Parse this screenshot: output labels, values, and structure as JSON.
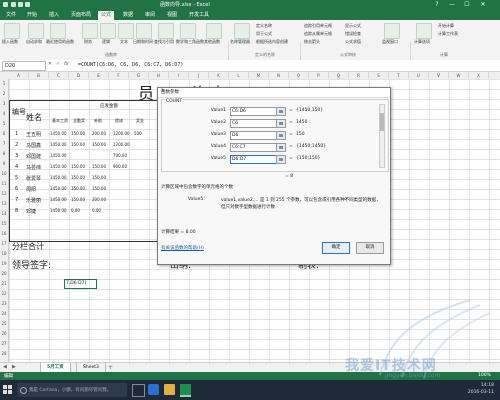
{
  "window": {
    "title": "函数向导.xlsx - Excel",
    "controls": [
      "?",
      "—",
      "☐",
      "✕"
    ]
  },
  "ribbon_tabs": [
    "文件",
    "开始",
    "插入",
    "页面布局",
    "公式",
    "数据",
    "审阅",
    "视图",
    "开发工具"
  ],
  "active_tab_index": 4,
  "ribbon": {
    "buttons": [
      {
        "label": "插入函数"
      },
      {
        "label": "自动求和"
      },
      {
        "label": "最近使用的函数"
      },
      {
        "label": "财务"
      },
      {
        "label": "逻辑"
      },
      {
        "label": "文本"
      },
      {
        "label": "日期和时间"
      },
      {
        "label": "查找与引用"
      },
      {
        "label": "数学和三角函数"
      },
      {
        "label": "其他函数"
      },
      {
        "label": "名称管理器"
      },
      {
        "label": "计算选项"
      }
    ],
    "small_items": [
      "定义名称",
      "用于公式",
      "根据所选内容创建",
      "追踪引用单元格",
      "追踪从属单元格",
      "移去箭头",
      "显示公式",
      "错误检查",
      "公式求值",
      "监视窗口",
      "开始计算",
      "计算工作表"
    ],
    "groups": [
      "函数库",
      "定义的名称",
      "公式审核",
      "计算"
    ]
  },
  "formula_bar": {
    "name_box": "D20",
    "fx": "fx",
    "formula": "=COUNT(C6:D6, C6, D6, C6:C7, D6:D7)"
  },
  "columns": [
    "A",
    "B",
    "C",
    "D",
    "E",
    "F",
    "G",
    "H",
    "I",
    "J",
    "K",
    "L",
    "M",
    "N",
    "O",
    "P",
    "Q",
    "R",
    "S",
    "T",
    "U",
    "V",
    "W",
    "X"
  ],
  "rows": [
    "1",
    "2",
    "3",
    "4",
    "5",
    "6",
    "7",
    "8",
    "9",
    "10",
    "11",
    "12",
    "13",
    "14",
    "15",
    "16",
    "17",
    "18",
    "19",
    "20",
    "21",
    "22",
    "23",
    "24",
    "25",
    "26",
    "27",
    "28"
  ],
  "sheet": {
    "title": "员工工资表",
    "header_index": "编号",
    "header_name": "姓名",
    "header_group": "应发金额",
    "subheaders": [
      "基本工资",
      "全勤奖",
      "补助",
      "提成",
      "奖金"
    ],
    "rows": [
      {
        "no": "1",
        "name": "王五明",
        "vals": [
          "1450.00",
          "150.00",
          "200.00",
          "1200.00",
          "500"
        ]
      },
      {
        "no": "2",
        "name": "马国鑫",
        "vals": [
          "1450.00",
          "150.00",
          "350.00",
          "1200.00",
          ""
        ]
      },
      {
        "no": "3",
        "name": "邓国建",
        "vals": [
          "1450.00",
          "",
          "",
          "700.00",
          ""
        ]
      },
      {
        "no": "4",
        "name": "马芸缔",
        "vals": [
          "1450.00",
          "150.00",
          "150.00",
          "900.00",
          ""
        ]
      },
      {
        "no": "5",
        "name": "张爱琴",
        "vals": [
          "1450.00",
          "150.00",
          "150.00",
          "",
          ""
        ]
      },
      {
        "no": "6",
        "name": "周阳",
        "vals": [
          "1450.00",
          "150.00",
          "150.00",
          "",
          ""
        ]
      },
      {
        "no": "7",
        "name": "乐雅丽",
        "vals": [
          "1450.00",
          "150.00",
          "200.00",
          "",
          ""
        ]
      },
      {
        "no": "8",
        "name": "邓婕",
        "vals": [
          "1450.00",
          "0.00",
          "0.00",
          "",
          ""
        ]
      }
    ],
    "subtotal": "分栏合计",
    "sign_leader": "领导签字:",
    "sign_cashier": "出纳:",
    "sign_maker": "制表:",
    "editing_cell": "7,D6:D7)"
  },
  "dialog": {
    "title": "函数参数",
    "help_icon": "?",
    "close_icon": "✕",
    "function_name": "COUNT",
    "args": [
      {
        "label": "Value1",
        "input": "C6:D6",
        "result": "{1450,150}"
      },
      {
        "label": "Value2",
        "input": "C6",
        "result": "1450"
      },
      {
        "label": "Value3",
        "input": "D6",
        "result": "150"
      },
      {
        "label": "Value4",
        "input": "C6:C7",
        "result": "{1450;1450}"
      },
      {
        "label": "Value5",
        "input": "D6:D7",
        "result": "{150;150}"
      }
    ],
    "result_preview": "= 8",
    "description": "计算区域中包含数字的单元格的个数",
    "arg_hint_label": "Value5:",
    "arg_hint": "value1,value2,... 是 1 到 255 个参数，可以包含或引用各种不同类型的数据，但只对数字型数据进行计数",
    "formula_result_label": "计算结果 =",
    "formula_result": "8.00",
    "help_link": "有关该函数的帮助(H)",
    "ok": "确定",
    "cancel": "取消"
  },
  "sheet_tabs": [
    "5月工资",
    "Sheet3"
  ],
  "add_sheet": "+",
  "status": {
    "left": "编辑",
    "right": "100%"
  },
  "taskbar": {
    "search_placeholder": "我是 Cortana，小娜。有问题尽管问我。",
    "time": "14:18",
    "date": "2016-03-11"
  },
  "watermark": {
    "main": "我爱IT技术网",
    "url": "jingyan.baidu.com"
  },
  "colors": {
    "excel_green": "#217346",
    "taskbar": "#1f2a38",
    "link": "#1a5fb4"
  }
}
